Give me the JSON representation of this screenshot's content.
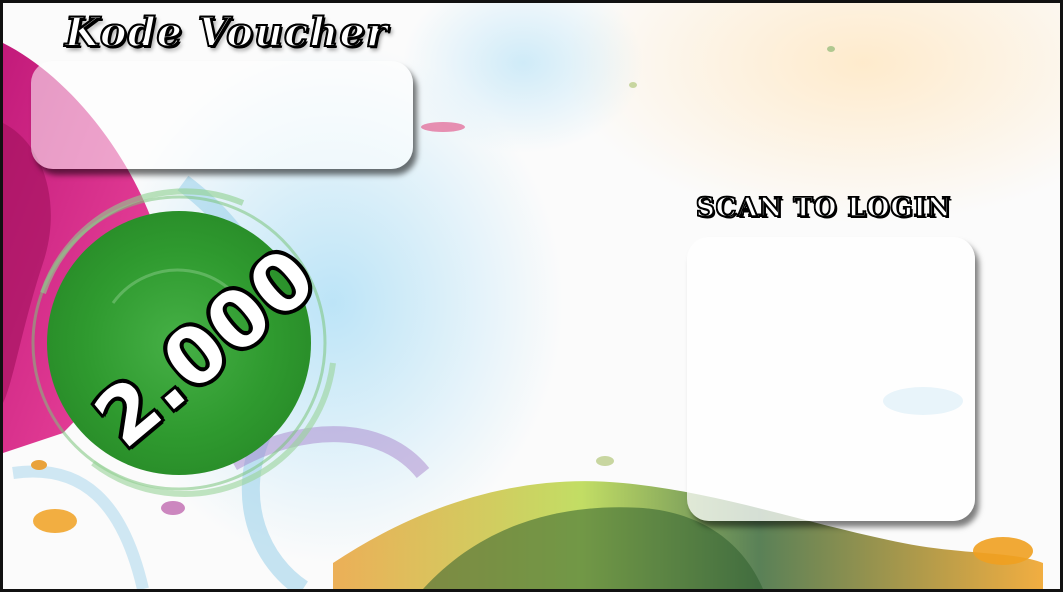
{
  "voucher": {
    "title": "Kode Voucher",
    "price": "2.000",
    "scan_label": "SCAN TO LOGIN"
  },
  "colors": {
    "badge_green": "#3aa53a",
    "splash_magenta": "#e0157a",
    "splash_orange": "#f0a020",
    "splash_lime": "#b8d84a",
    "splash_blue": "#5aaee0"
  }
}
